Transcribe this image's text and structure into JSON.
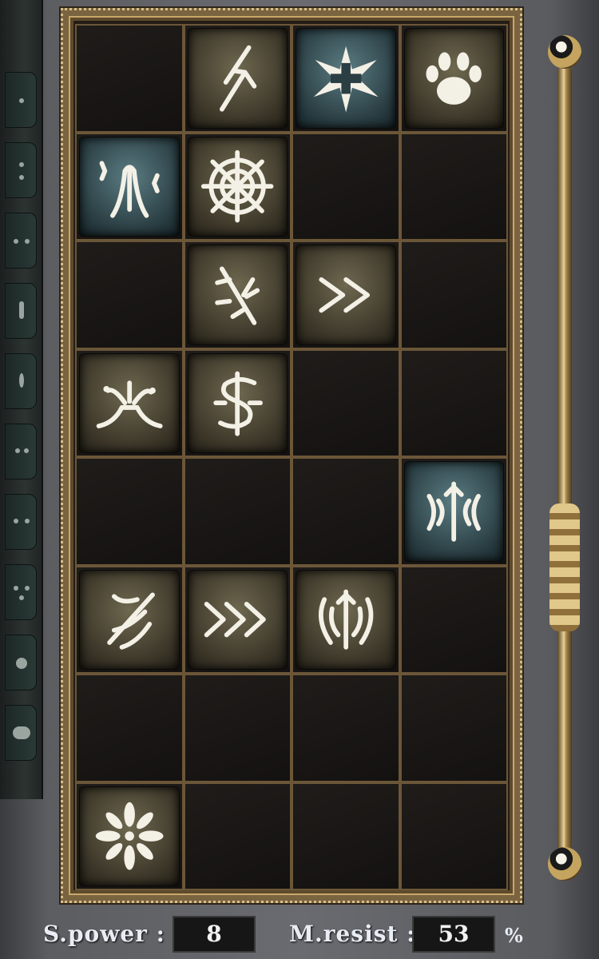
{
  "skill_grid": {
    "columns": 4,
    "rows": 8,
    "slots": [
      {
        "icon": "",
        "color": ""
      },
      {
        "icon": "lightning-bolt-icon",
        "color": "#3b3628"
      },
      {
        "icon": "radiant-star-icon",
        "color": "#2a3e43"
      },
      {
        "icon": "paw-print-icon",
        "color": "#3b3628"
      },
      {
        "icon": "praying-hands-icon",
        "color": "#2a3e43"
      },
      {
        "icon": "spider-web-icon",
        "color": "#3b3628"
      },
      {
        "icon": "",
        "color": ""
      },
      {
        "icon": "",
        "color": ""
      },
      {
        "icon": "",
        "color": ""
      },
      {
        "icon": "shattered-sword-icon",
        "color": "#3b3628"
      },
      {
        "icon": "double-chevron-icon",
        "color": "#3b3628"
      },
      {
        "icon": "",
        "color": ""
      },
      {
        "icon": "volcano-icon",
        "color": "#3b3628"
      },
      {
        "icon": "rune-sigil-icon",
        "color": "#3b3628"
      },
      {
        "icon": "",
        "color": ""
      },
      {
        "icon": "",
        "color": ""
      },
      {
        "icon": "",
        "color": ""
      },
      {
        "icon": "",
        "color": ""
      },
      {
        "icon": "",
        "color": ""
      },
      {
        "icon": "tribal-shield-icon",
        "color": "#2a3e43"
      },
      {
        "icon": "wind-gust-icon",
        "color": "#3b3628"
      },
      {
        "icon": "triple-chevron-icon",
        "color": "#3b3628"
      },
      {
        "icon": "tribal-crest-icon",
        "color": "#3b3628"
      },
      {
        "icon": "",
        "color": ""
      },
      {
        "icon": "",
        "color": ""
      },
      {
        "icon": "",
        "color": ""
      },
      {
        "icon": "",
        "color": ""
      },
      {
        "icon": "",
        "color": ""
      },
      {
        "icon": "petal-burst-icon",
        "color": "#3b3628"
      },
      {
        "icon": "",
        "color": ""
      },
      {
        "icon": "",
        "color": ""
      },
      {
        "icon": "",
        "color": ""
      }
    ]
  },
  "stats": {
    "spell_power_label": "S.power :",
    "spell_power_value": "8",
    "magic_resist_label": "M.resist :",
    "magic_resist_value": "53",
    "percent_sign": "%"
  },
  "colors": {
    "frame_gold": "#c9a86a",
    "icon_white": "#f3f0e6",
    "panel_stone": "#5c5d61"
  }
}
